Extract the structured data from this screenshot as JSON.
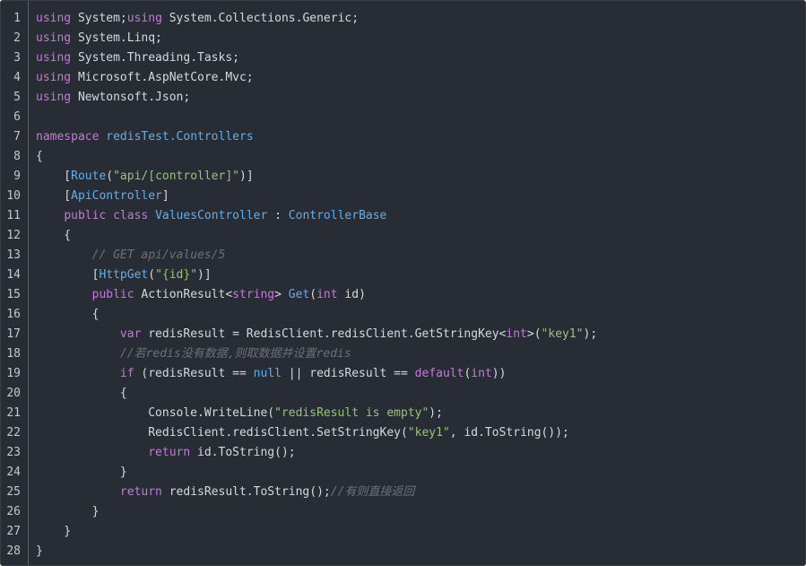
{
  "editor": {
    "language": "C#",
    "colors": {
      "background": "#282c34",
      "keyword": "#c678dd",
      "plain": "#d6d9de",
      "identifier": "#61afef",
      "string": "#98c379",
      "comment": "#6b717c",
      "line_number": "#c6c8cc"
    },
    "lines": [
      {
        "n": "1",
        "tokens": [
          {
            "t": "using",
            "c": "kw"
          },
          {
            "t": " System;",
            "c": "plain"
          },
          {
            "t": "using",
            "c": "kw"
          },
          {
            "t": " System.Collections.Generic;",
            "c": "plain"
          }
        ]
      },
      {
        "n": "2",
        "tokens": [
          {
            "t": "using",
            "c": "kw"
          },
          {
            "t": " System.Linq;",
            "c": "plain"
          }
        ]
      },
      {
        "n": "3",
        "tokens": [
          {
            "t": "using",
            "c": "kw"
          },
          {
            "t": " System.Threading.Tasks;",
            "c": "plain"
          }
        ]
      },
      {
        "n": "4",
        "tokens": [
          {
            "t": "using",
            "c": "kw"
          },
          {
            "t": " Microsoft.AspNetCore.Mvc;",
            "c": "plain"
          }
        ]
      },
      {
        "n": "5",
        "tokens": [
          {
            "t": "using",
            "c": "kw"
          },
          {
            "t": " Newtonsoft.Json;",
            "c": "plain"
          }
        ]
      },
      {
        "n": "6",
        "tokens": []
      },
      {
        "n": "7",
        "tokens": [
          {
            "t": "namespace",
            "c": "kw"
          },
          {
            "t": " ",
            "c": "plain"
          },
          {
            "t": "redisTest.Controllers",
            "c": "blue"
          }
        ]
      },
      {
        "n": "8",
        "tokens": [
          {
            "t": "{",
            "c": "plain"
          }
        ]
      },
      {
        "n": "9",
        "tokens": [
          {
            "t": "    [",
            "c": "plain"
          },
          {
            "t": "Route",
            "c": "blue"
          },
          {
            "t": "(",
            "c": "plain"
          },
          {
            "t": "\"api/[controller]\"",
            "c": "str"
          },
          {
            "t": ")]",
            "c": "plain"
          }
        ]
      },
      {
        "n": "10",
        "tokens": [
          {
            "t": "    [",
            "c": "plain"
          },
          {
            "t": "ApiController",
            "c": "blue"
          },
          {
            "t": "]",
            "c": "plain"
          }
        ]
      },
      {
        "n": "11",
        "tokens": [
          {
            "t": "    ",
            "c": "plain"
          },
          {
            "t": "public",
            "c": "kw"
          },
          {
            "t": " ",
            "c": "plain"
          },
          {
            "t": "class",
            "c": "kw"
          },
          {
            "t": " ",
            "c": "plain"
          },
          {
            "t": "ValuesController",
            "c": "blue"
          },
          {
            "t": " : ",
            "c": "plain"
          },
          {
            "t": "ControllerBase",
            "c": "blue"
          }
        ]
      },
      {
        "n": "12",
        "tokens": [
          {
            "t": "    {",
            "c": "plain"
          }
        ]
      },
      {
        "n": "13",
        "tokens": [
          {
            "t": "        ",
            "c": "plain"
          },
          {
            "t": "// GET api/values/5",
            "c": "cmt"
          }
        ]
      },
      {
        "n": "14",
        "tokens": [
          {
            "t": "        [",
            "c": "plain"
          },
          {
            "t": "HttpGet",
            "c": "blue"
          },
          {
            "t": "(",
            "c": "plain"
          },
          {
            "t": "\"{id}\"",
            "c": "str"
          },
          {
            "t": ")]",
            "c": "plain"
          }
        ]
      },
      {
        "n": "15",
        "tokens": [
          {
            "t": "        ",
            "c": "plain"
          },
          {
            "t": "public",
            "c": "kw"
          },
          {
            "t": " ActionResult<",
            "c": "plain"
          },
          {
            "t": "string",
            "c": "kw"
          },
          {
            "t": "> ",
            "c": "plain"
          },
          {
            "t": "Get",
            "c": "blue"
          },
          {
            "t": "(",
            "c": "plain"
          },
          {
            "t": "int",
            "c": "kw"
          },
          {
            "t": " id)",
            "c": "plain"
          }
        ]
      },
      {
        "n": "16",
        "tokens": [
          {
            "t": "        {",
            "c": "plain"
          }
        ]
      },
      {
        "n": "17",
        "tokens": [
          {
            "t": "            ",
            "c": "plain"
          },
          {
            "t": "var",
            "c": "kw"
          },
          {
            "t": " redisResult = RedisClient.redisClient.GetStringKey<",
            "c": "plain"
          },
          {
            "t": "int",
            "c": "kw"
          },
          {
            "t": ">(",
            "c": "plain"
          },
          {
            "t": "\"key1\"",
            "c": "str"
          },
          {
            "t": ");",
            "c": "plain"
          }
        ]
      },
      {
        "n": "18",
        "tokens": [
          {
            "t": "            ",
            "c": "plain"
          },
          {
            "t": "//若redis没有数据,则取数据并设置redis",
            "c": "cmt"
          }
        ]
      },
      {
        "n": "19",
        "tokens": [
          {
            "t": "            ",
            "c": "plain"
          },
          {
            "t": "if",
            "c": "kw"
          },
          {
            "t": " (redisResult == ",
            "c": "plain"
          },
          {
            "t": "null",
            "c": "blue"
          },
          {
            "t": " || redisResult == ",
            "c": "plain"
          },
          {
            "t": "default",
            "c": "kw"
          },
          {
            "t": "(",
            "c": "plain"
          },
          {
            "t": "int",
            "c": "kw"
          },
          {
            "t": "))",
            "c": "plain"
          }
        ]
      },
      {
        "n": "20",
        "tokens": [
          {
            "t": "            {",
            "c": "plain"
          }
        ]
      },
      {
        "n": "21",
        "tokens": [
          {
            "t": "                Console.WriteLine(",
            "c": "plain"
          },
          {
            "t": "\"redisResult is empty\"",
            "c": "str"
          },
          {
            "t": ");",
            "c": "plain"
          }
        ]
      },
      {
        "n": "22",
        "tokens": [
          {
            "t": "                RedisClient.redisClient.SetStringKey(",
            "c": "plain"
          },
          {
            "t": "\"key1\"",
            "c": "str"
          },
          {
            "t": ", id.ToString());",
            "c": "plain"
          }
        ]
      },
      {
        "n": "23",
        "tokens": [
          {
            "t": "                ",
            "c": "plain"
          },
          {
            "t": "return",
            "c": "kw"
          },
          {
            "t": " id.ToString();",
            "c": "plain"
          }
        ]
      },
      {
        "n": "24",
        "tokens": [
          {
            "t": "            }",
            "c": "plain"
          }
        ]
      },
      {
        "n": "25",
        "tokens": [
          {
            "t": "            ",
            "c": "plain"
          },
          {
            "t": "return",
            "c": "kw"
          },
          {
            "t": " redisResult.ToString();",
            "c": "plain"
          },
          {
            "t": "//有则直接返回",
            "c": "cmt"
          }
        ]
      },
      {
        "n": "26",
        "tokens": [
          {
            "t": "        }",
            "c": "plain"
          }
        ]
      },
      {
        "n": "27",
        "tokens": [
          {
            "t": "    }",
            "c": "plain"
          }
        ]
      },
      {
        "n": "28",
        "tokens": [
          {
            "t": "}",
            "c": "plain"
          }
        ]
      }
    ]
  }
}
